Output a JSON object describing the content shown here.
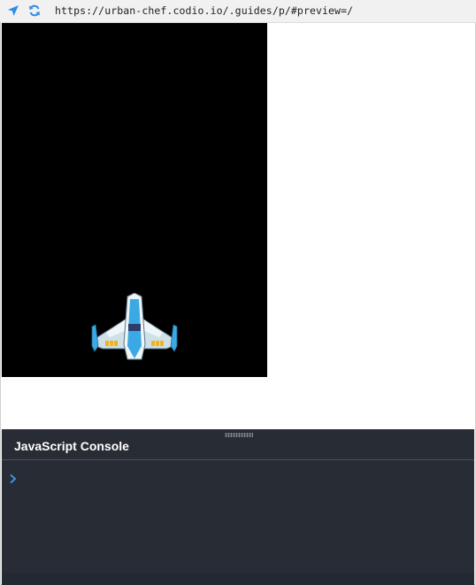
{
  "browser": {
    "url": "https://urban-chef.codio.io/.guides/p/#preview=/",
    "icons": {
      "navigate": "location-arrow-icon",
      "refresh": "refresh-icon"
    },
    "accent": "#2d8ee6"
  },
  "preview": {
    "canvas_background": "#000000",
    "sprite": "spaceship-icon"
  },
  "console": {
    "title": "JavaScript Console",
    "prompt_icon": "chevron-right-icon",
    "input_value": "",
    "background": "#282c34",
    "prompt_color": "#3d8fe8"
  }
}
